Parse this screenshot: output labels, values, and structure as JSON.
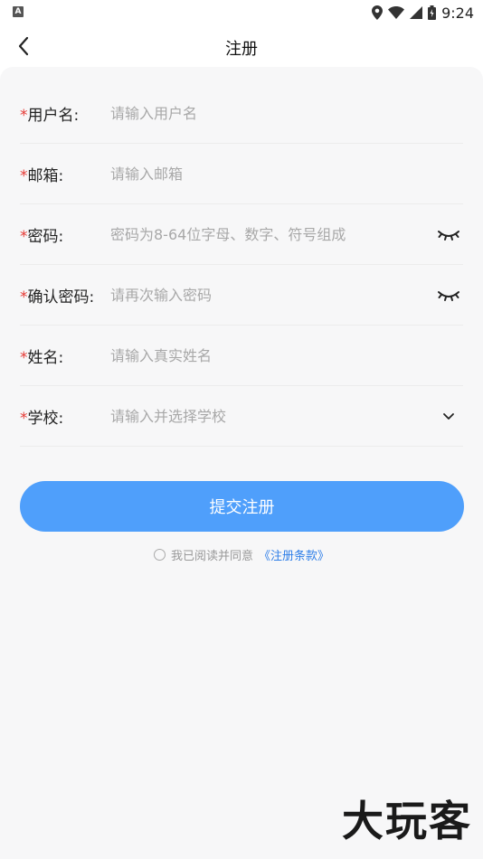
{
  "status_bar": {
    "time": "9:24",
    "notif_icon_text": "A"
  },
  "header": {
    "title": "注册"
  },
  "form": {
    "required_mark": "*",
    "fields": [
      {
        "label": "用户名:",
        "placeholder": "请输入用户名",
        "value": ""
      },
      {
        "label": "邮箱:",
        "placeholder": "请输入邮箱",
        "value": ""
      },
      {
        "label": "密码:",
        "placeholder": "密码为8-64位字母、数字、符号组成",
        "value": ""
      },
      {
        "label": "确认密码:",
        "placeholder": "请再次输入密码",
        "value": ""
      },
      {
        "label": "姓名:",
        "placeholder": "请输入真实姓名",
        "value": ""
      },
      {
        "label": "学校:",
        "placeholder": "请输入并选择学校",
        "value": ""
      }
    ]
  },
  "submit_label": "提交注册",
  "agreement": {
    "text": "我已阅读并同意",
    "link": "《注册条款》"
  },
  "watermark": "大玩客",
  "colors": {
    "accent": "#4f9ffb",
    "required": "#e53935",
    "link": "#2f7fe8"
  }
}
